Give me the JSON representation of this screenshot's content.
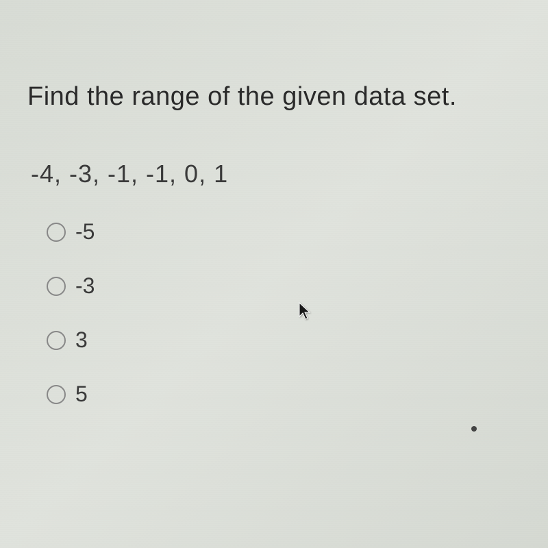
{
  "question": {
    "prompt": "Find the range of the given data set.",
    "data_set": "-4, -3, -1, -1, 0, 1"
  },
  "options": [
    {
      "label": "-5"
    },
    {
      "label": "-3"
    },
    {
      "label": "3"
    },
    {
      "label": "5"
    }
  ]
}
